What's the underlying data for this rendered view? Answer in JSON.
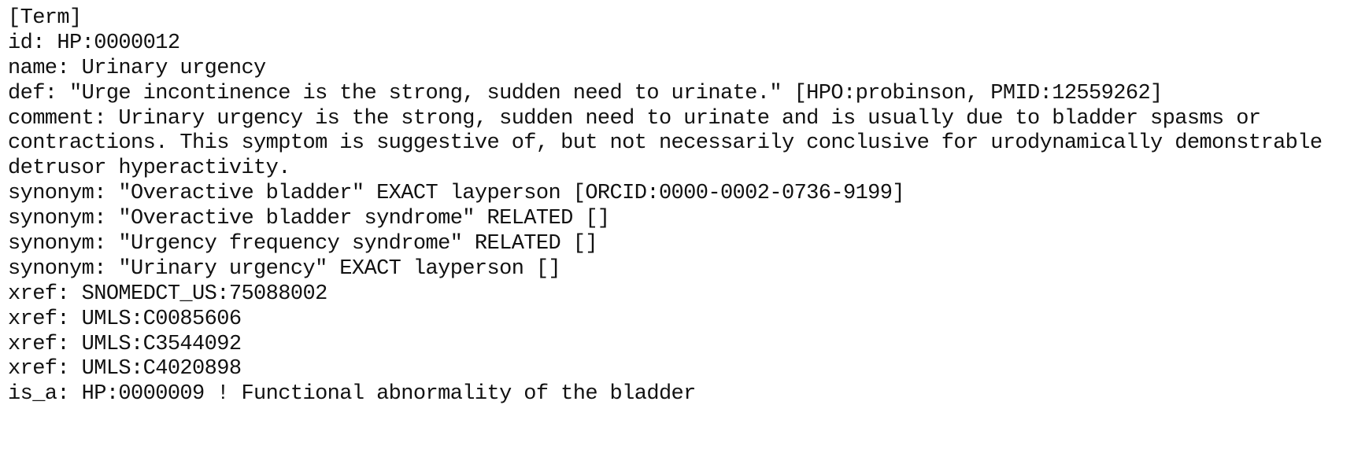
{
  "document": {
    "lines": [
      "[Term]",
      "id: HP:0000012",
      "name: Urinary urgency",
      "def: \"Urge incontinence is the strong, sudden need to urinate.\" [HPO:probinson, PMID:12559262]",
      "comment: Urinary urgency is the strong, sudden need to urinate and is usually due to bladder spasms or",
      "contractions. This symptom is suggestive of, but not necessarily conclusive for urodynamically demonstrable",
      "detrusor hyperactivity.",
      "synonym: \"Overactive bladder\" EXACT layperson [ORCID:0000-0002-0736-9199]",
      "synonym: \"Overactive bladder syndrome\" RELATED []",
      "synonym: \"Urgency frequency syndrome\" RELATED []",
      "synonym: \"Urinary urgency\" EXACT layperson []",
      "xref: SNOMEDCT_US:75088002",
      "xref: UMLS:C0085606",
      "xref: UMLS:C3544092",
      "xref: UMLS:C4020898",
      "is_a: HP:0000009 ! Functional abnormality of the bladder"
    ]
  }
}
